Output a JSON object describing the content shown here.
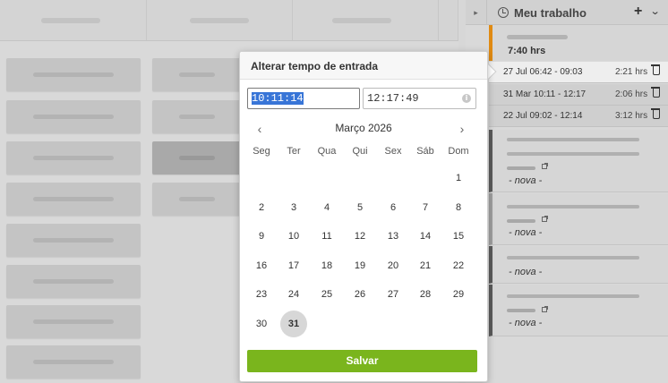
{
  "panel": {
    "title": "Meu trabalho",
    "add_label": "+",
    "menu_label": "⌄",
    "collapse_label": "▸",
    "total_hours": "7:40 hrs",
    "entries": [
      {
        "range": "27 Jul 06:42 - 09:03",
        "duration": "2:21 hrs"
      },
      {
        "range": "31 Mar 10:11 - 12:17",
        "duration": "2:06 hrs"
      },
      {
        "range": "22 Jul 09:02 - 12:14",
        "duration": "3:12 hrs"
      }
    ],
    "tasks": [
      {
        "label": "- nova -"
      },
      {
        "label": "- nova -"
      },
      {
        "label": "- nova -"
      },
      {
        "label": "- nova -"
      }
    ]
  },
  "popup": {
    "title": "Alterar tempo de entrada",
    "start_time": "10:11:14",
    "end_time": "12:17:49",
    "info_icon": "i",
    "prev_label": "‹",
    "next_label": "›",
    "month": "Março 2026",
    "weekdays": [
      "Seg",
      "Ter",
      "Qua",
      "Qui",
      "Sex",
      "Sáb",
      "Dom"
    ],
    "weeks": [
      [
        "",
        "",
        "",
        "",
        "",
        "",
        "1"
      ],
      [
        "2",
        "3",
        "4",
        "5",
        "6",
        "7",
        "8"
      ],
      [
        "9",
        "10",
        "11",
        "12",
        "13",
        "14",
        "15"
      ],
      [
        "16",
        "17",
        "18",
        "19",
        "20",
        "21",
        "22"
      ],
      [
        "23",
        "24",
        "25",
        "26",
        "27",
        "28",
        "29"
      ],
      [
        "30",
        "31",
        "",
        "",
        "",
        "",
        ""
      ]
    ],
    "selected_day": "31",
    "save_label": "Salvar"
  },
  "icons": {
    "clock": "clock-icon",
    "trash": "trash-icon",
    "external": "external-link-icon",
    "info": "info-icon"
  },
  "colors": {
    "accent_orange": "#e08a12",
    "save_green": "#7ab51d",
    "selection_blue": "#3875d7"
  }
}
